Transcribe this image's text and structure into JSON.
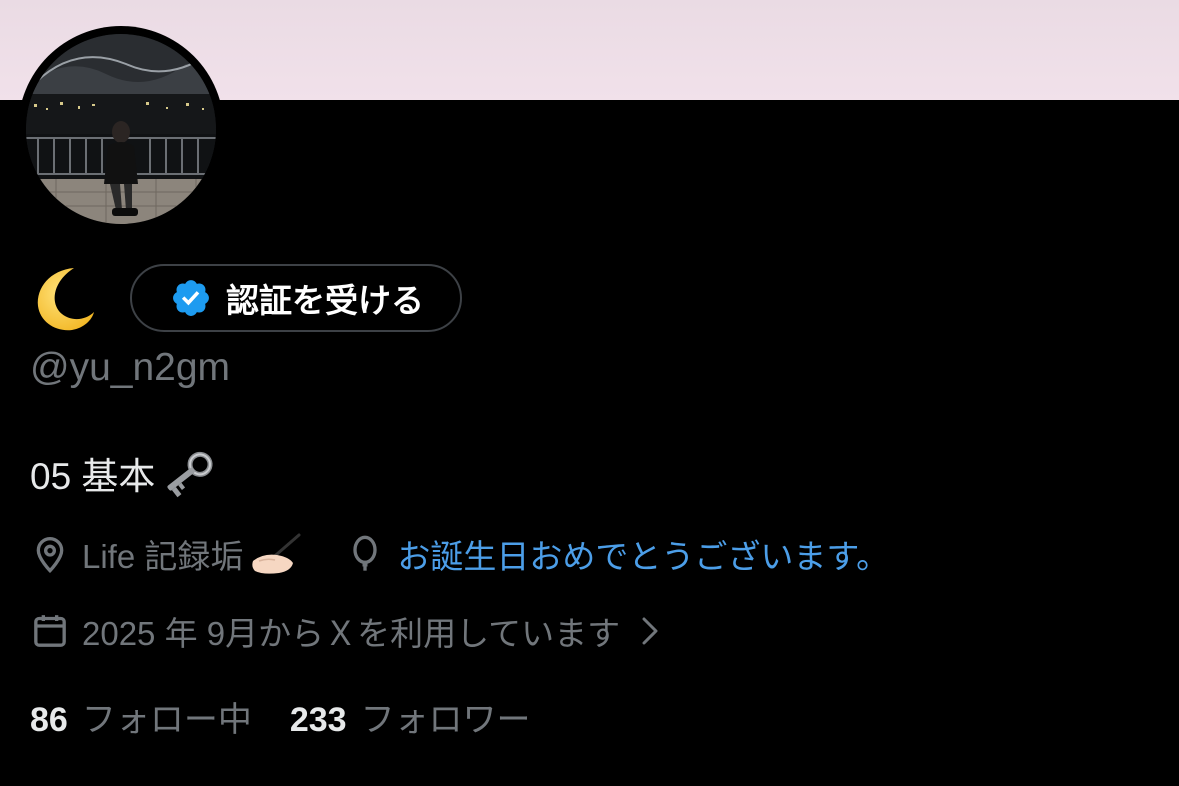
{
  "profile": {
    "display_name_icon": "crescent-moon-emoji",
    "verify_button_label": "認証を受ける",
    "verify_icon": "verified-badge-icon",
    "handle": "@yu_n2gm",
    "bio_text": "05 基本",
    "bio_icon": "old-key-emoji",
    "location": "Life 記録垢",
    "location_icon": "location-pin-icon",
    "location_emoji": "writing-hand-emoji",
    "birthday_text": "お誕生日おめでとうございます。",
    "birthday_icon": "balloon-icon",
    "joined_text": "2025 年 9月からＸを利用しています",
    "joined_icon": "calendar-icon",
    "following_count": "86",
    "following_label": "フォロー中",
    "followers_count": "233",
    "followers_label": "フォロワー"
  },
  "colors": {
    "background": "#000000",
    "banner": "#eadbe4",
    "text_primary": "#e7e9ea",
    "text_secondary": "#71767b",
    "link": "#4c9ee8",
    "verified_badge": "#1d9bf0"
  }
}
